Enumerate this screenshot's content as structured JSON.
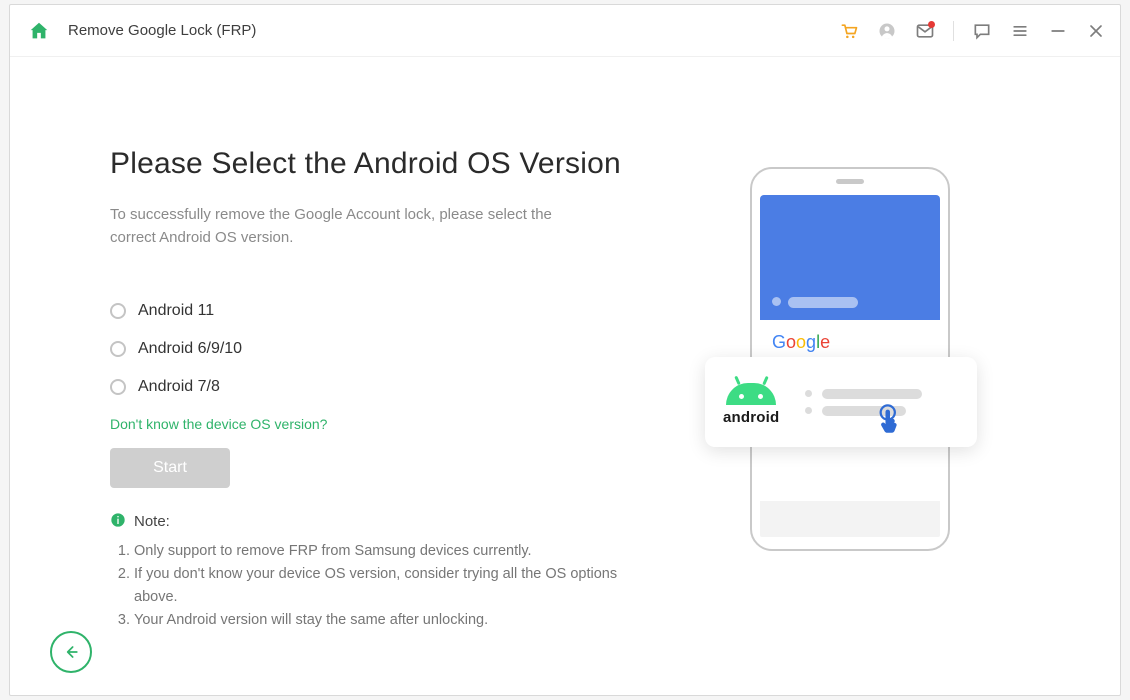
{
  "titlebar": {
    "title": "Remove Google Lock (FRP)"
  },
  "main": {
    "heading": "Please Select the Android OS Version",
    "subtext": "To successfully remove the Google Account lock, please select the correct Android OS version.",
    "options": [
      "Android 11",
      "Android 6/9/10",
      "Android 7/8"
    ],
    "help_link": "Don't know the device OS version?",
    "start_label": "Start",
    "note_label": "Note:",
    "notes": [
      "Only support to remove FRP from Samsung devices currently.",
      "If you don't know your device OS version, consider trying all the OS options above.",
      "Your Android version will stay the same after unlocking."
    ]
  },
  "illustration": {
    "google_word": "Google",
    "android_word": "android"
  }
}
